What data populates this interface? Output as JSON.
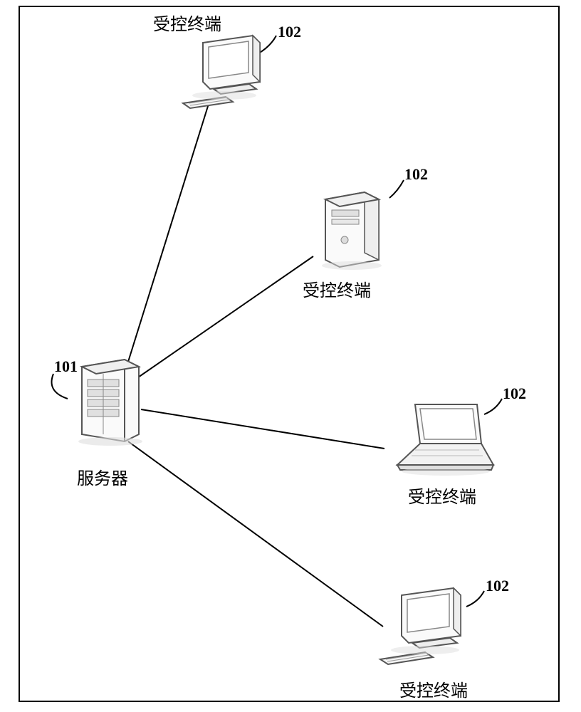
{
  "diagram": {
    "nodes": {
      "server": {
        "label": "服务器",
        "ref": "101",
        "type": "server-rack"
      },
      "terminal_top": {
        "label": "受控终端",
        "ref": "102",
        "type": "desktop-monitor-keyboard"
      },
      "terminal_tower": {
        "label": "受控终端",
        "ref": "102",
        "type": "tower-pc"
      },
      "terminal_laptop": {
        "label": "受控终端",
        "ref": "102",
        "type": "laptop"
      },
      "terminal_bottom": {
        "label": "受控终端",
        "ref": "102",
        "type": "desktop-monitor-keyboard"
      }
    }
  }
}
